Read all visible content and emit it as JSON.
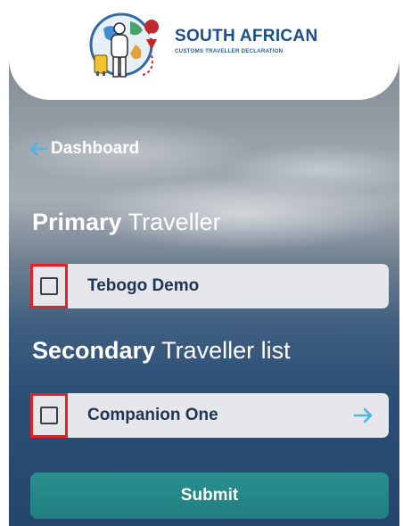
{
  "brand": {
    "title": "SOUTH AFRICAN",
    "subtitle": "CUSTOMS TRAVELLER DECLARATION"
  },
  "nav": {
    "back_label": "Dashboard"
  },
  "primary": {
    "title_strong": "Primary",
    "title_rest": " Traveller",
    "traveller": {
      "name": "Tebogo Demo",
      "checked": false
    }
  },
  "secondary": {
    "title_strong": "Secondary",
    "title_rest": " Traveller list",
    "travellers": [
      {
        "name": "Companion One",
        "checked": false
      }
    ]
  },
  "actions": {
    "submit_label": "Submit"
  },
  "colors": {
    "brand_blue": "#1c4f8a",
    "accent_arrow": "#4fb3e3",
    "submit_teal": "#217f80",
    "highlight_red": "#e3232a"
  }
}
